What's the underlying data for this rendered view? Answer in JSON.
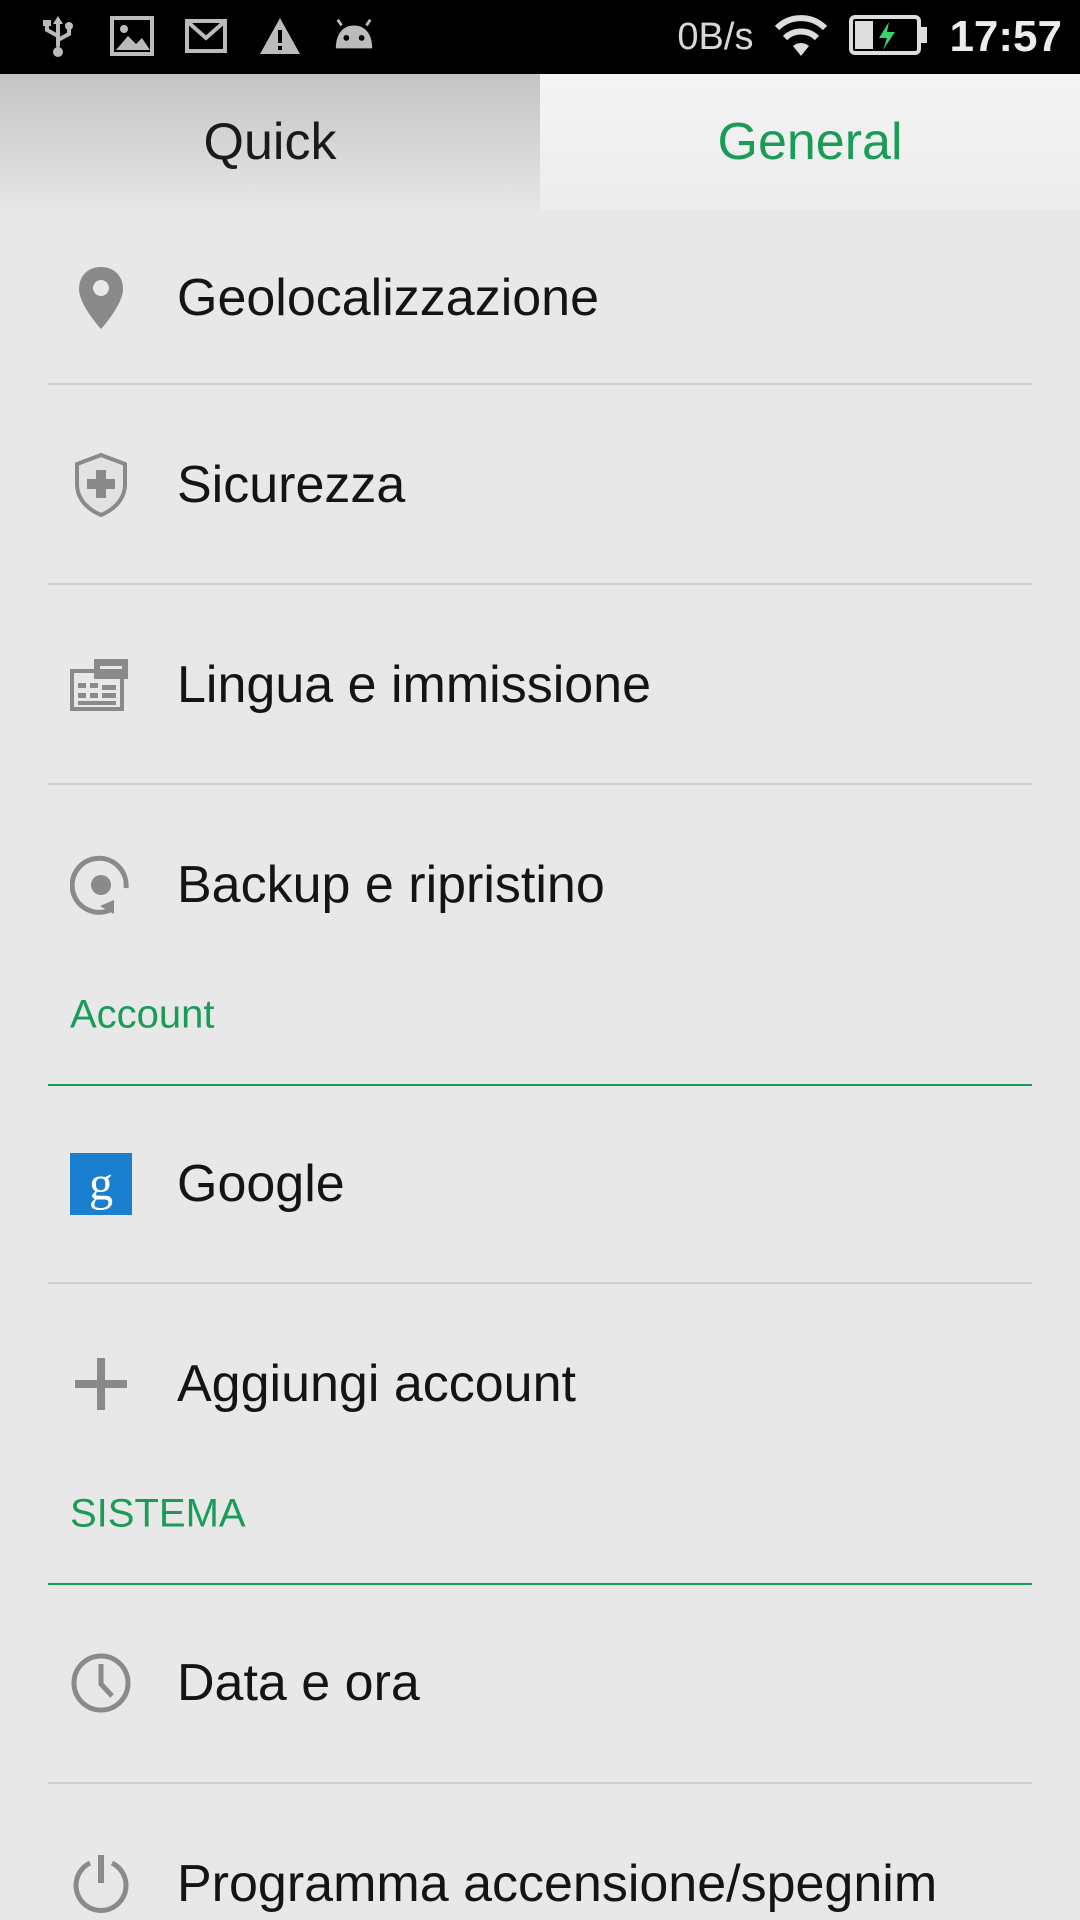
{
  "status_bar": {
    "icons": [
      "usb-icon",
      "image-icon",
      "gmail-icon",
      "warning-icon",
      "android-icon"
    ],
    "net_speed": "0B/s",
    "time": "17:57"
  },
  "tabs": [
    {
      "label": "Quick",
      "active": false
    },
    {
      "label": "General",
      "active": true
    }
  ],
  "items": {
    "geolocation": "Geolocalizzazione",
    "security": "Sicurezza",
    "language": "Lingua e immissione",
    "backup": "Backup e ripristino",
    "google": "Google",
    "add_account": "Aggiungi account",
    "date_time": "Data e ora",
    "power_schedule": "Programma accensione/spegnim"
  },
  "sections": {
    "account": "Account",
    "system": "SISTEMA"
  },
  "colors": {
    "accent": "#1a9c57",
    "google_blue": "#1b7fcf"
  }
}
